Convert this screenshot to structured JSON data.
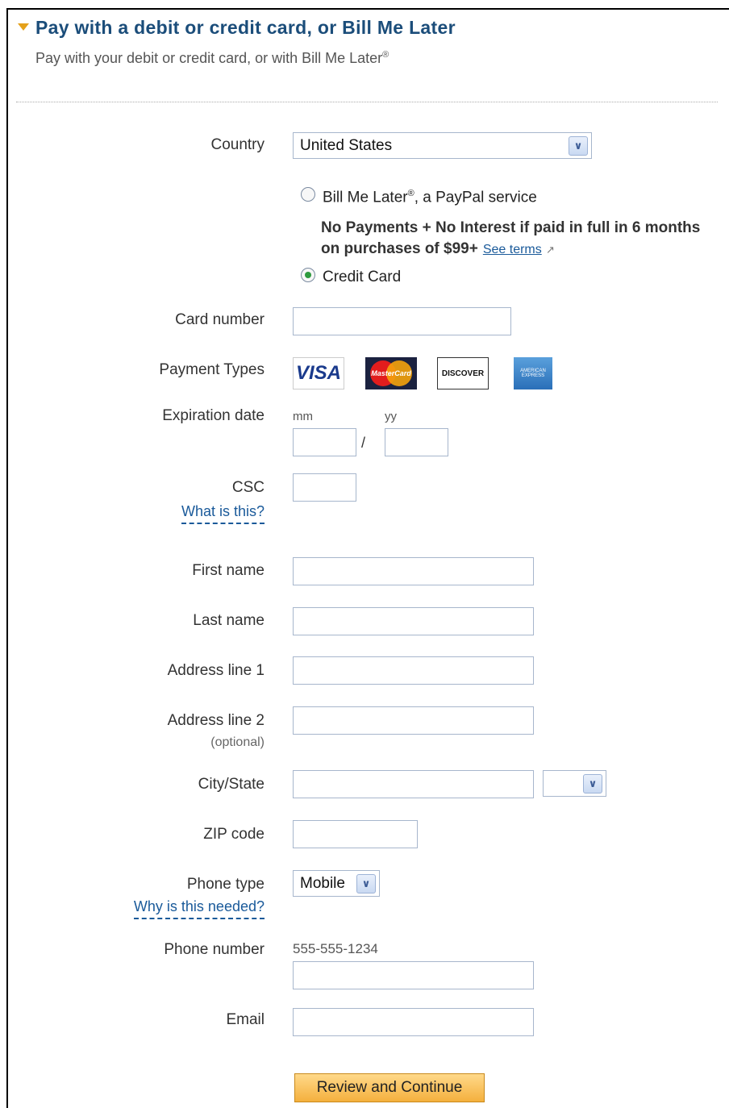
{
  "header": {
    "title": "Pay with a debit or credit card, or Bill Me Later",
    "subtitle": "Pay with your debit or credit card, or with Bill Me Later",
    "subtitle_mark": "®"
  },
  "country": {
    "label": "Country",
    "value": "United States"
  },
  "payment_method": {
    "bill_me_later_label": "Bill Me Later",
    "bill_me_later_mark": "®",
    "bill_me_later_suffix": ", a PayPal service",
    "promo_line1": "No Payments + No Interest if paid in full in 6 months",
    "promo_line2": "on purchases of $99+",
    "see_terms": "See terms",
    "credit_card_label": "Credit Card",
    "selected": "credit_card"
  },
  "card_number": {
    "label": "Card number",
    "value": ""
  },
  "payment_types": {
    "label": "Payment Types",
    "visa": "VISA",
    "mastercard": "MasterCard",
    "discover": "DISCOVER",
    "amex": "AMERICAN EXPRESS"
  },
  "expiration": {
    "label": "Expiration date",
    "mm_hint": "mm",
    "yy_hint": "yy",
    "separator": "/"
  },
  "csc": {
    "label": "CSC",
    "help": "What is this?"
  },
  "first_name": {
    "label": "First name"
  },
  "last_name": {
    "label": "Last name"
  },
  "address1": {
    "label": "Address line 1"
  },
  "address2": {
    "label": "Address line 2",
    "hint": "(optional)"
  },
  "city_state": {
    "label": "City/State",
    "state_value": ""
  },
  "zip": {
    "label": "ZIP code"
  },
  "phone_type": {
    "label": "Phone type",
    "value": "Mobile",
    "help": "Why is this needed?"
  },
  "phone_number": {
    "label": "Phone number",
    "example": "555-555-1234"
  },
  "email": {
    "label": "Email"
  },
  "submit": {
    "label": "Review and Continue"
  },
  "colors": {
    "heading": "#1b4d7a",
    "link": "#1a5a9a",
    "button": "#f4b03d",
    "radio_selected": "#2e9a3e"
  }
}
